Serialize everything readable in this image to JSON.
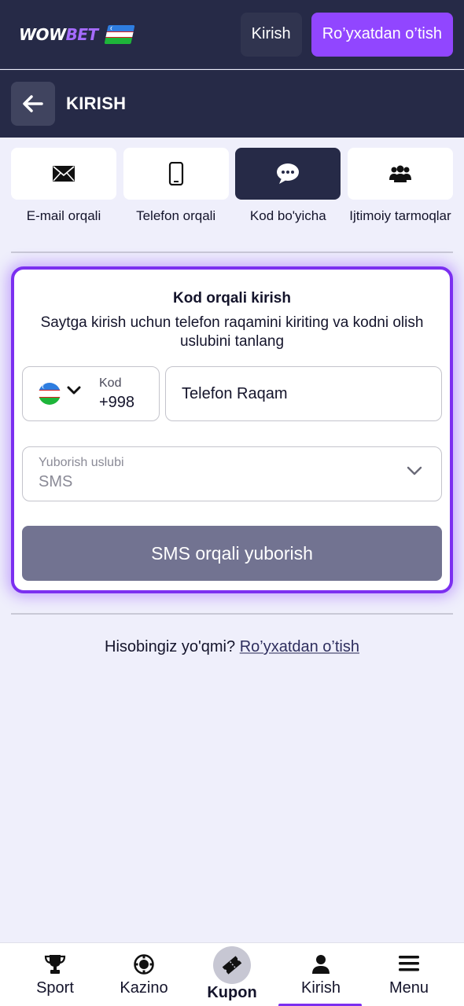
{
  "header": {
    "logo_part1": "WOW",
    "logo_part2": "BET",
    "login_label": "Kirish",
    "register_label": "Ro’yxatdan o’tish"
  },
  "subheader": {
    "title": "KIRISH"
  },
  "tabs": [
    {
      "label": "E-mail orqali",
      "icon": "envelope-icon"
    },
    {
      "label": "Telefon orqali",
      "icon": "phone-icon"
    },
    {
      "label": "Kod bo'yicha",
      "icon": "chat-bubble-icon",
      "active": true
    },
    {
      "label": "Ijtimoiy tarmoqlar",
      "icon": "users-icon"
    }
  ],
  "form": {
    "title": "Kod orqali kirish",
    "description": "Saytga kirish uchun telefon raqamini kiriting va kodni olish uslubini tanlang",
    "code_label": "Kod",
    "code_value": "+998",
    "phone_placeholder": "Telefon Raqam",
    "method_label": "Yuborish uslubi",
    "method_value": "SMS",
    "submit_label": "SMS orqali yuborish"
  },
  "account": {
    "question": "Hisobingiz yo'qmi?",
    "register_link": "Ro’yxatdan o’tish"
  },
  "bottom_nav": [
    {
      "label": "Sport",
      "icon": "trophy-icon"
    },
    {
      "label": "Kazino",
      "icon": "casino-chip-icon"
    },
    {
      "label": "Kupon",
      "icon": "ticket-icon"
    },
    {
      "label": "Kirish",
      "icon": "user-icon",
      "active": true
    },
    {
      "label": "Menu",
      "icon": "hamburger-icon"
    }
  ],
  "colors": {
    "header_bg": "#262a47",
    "accent": "#9146ff",
    "card_border": "#7b2ff0",
    "submit_bg": "#727391",
    "page_bg": "#efeffb"
  }
}
